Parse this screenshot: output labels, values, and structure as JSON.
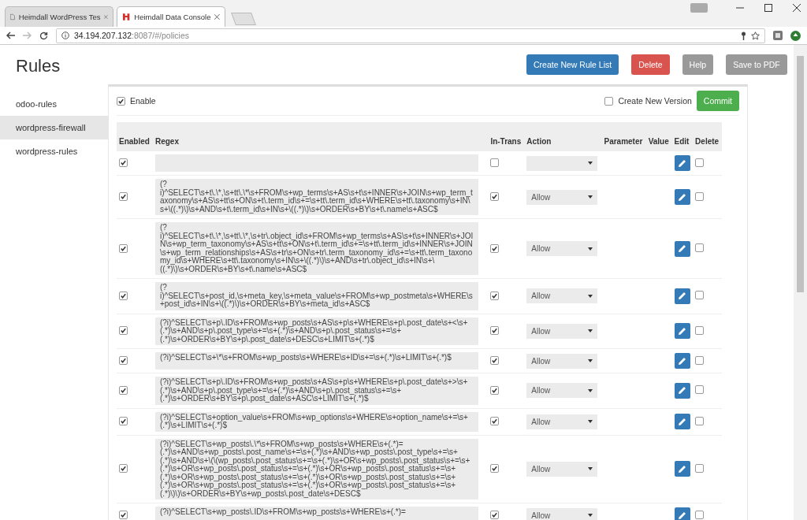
{
  "browser": {
    "tabs": [
      {
        "title": "Heimdall WordPress Tes",
        "kind": "page",
        "selected": false
      },
      {
        "title": "Heimdall Data Console",
        "kind": "logo",
        "selected": true
      }
    ],
    "url": {
      "host": "34.194.207.132",
      "rest": ":8087/#/policies"
    }
  },
  "page": {
    "title": "Rules",
    "buttons": [
      {
        "label": "Create New Rule List",
        "kind": "primary"
      },
      {
        "label": "Delete",
        "kind": "danger"
      },
      {
        "label": "Help",
        "kind": "default"
      },
      {
        "label": "Save to PDF",
        "kind": "default"
      }
    ]
  },
  "sidebar": {
    "items": [
      {
        "label": "odoo-rules",
        "selected": false
      },
      {
        "label": "wordpress-firewall",
        "selected": true
      },
      {
        "label": "wordpress-rules",
        "selected": false
      }
    ]
  },
  "panel": {
    "enable": {
      "label": "Enable",
      "checked": true
    },
    "new_version": {
      "label": "Create New Version",
      "checked": false
    },
    "commit": "Commit"
  },
  "table": {
    "columns": [
      "Enabled",
      "Regex",
      "In-Trans",
      "Action",
      "Parameter",
      "Value",
      "Edit",
      "Delete"
    ],
    "rows": [
      {
        "enabled": true,
        "regex": "",
        "in_trans": false,
        "action": "",
        "delete": false
      },
      {
        "enabled": true,
        "regex": "(?i)^SELECT\\s+t\\.\\*,\\s+tt\\.\\*\\s+FROM\\s+wp_terms\\s+AS\\s+t\\s+INNER\\s+JOIN\\s+wp_term_taxonomy\\s+AS\\s+tt\\s+ON\\s+t\\.term_id\\s+=\\s+tt\\.term_id\\s+WHERE\\s+tt\\.taxonomy\\s+IN\\s+\\((.*)\\)\\s+AND\\s+t\\.term_id\\s+IN\\s+\\((.*)\\)\\s+ORDER\\s+BY\\s+t\\.name\\s+ASC$",
        "in_trans": true,
        "action": "Allow",
        "delete": false
      },
      {
        "enabled": true,
        "regex": "(?i)^SELECT\\s+t\\.\\*,\\s+tt\\.\\*,\\s+tr\\.object_id\\s+FROM\\s+wp_terms\\s+AS\\s+t\\s+INNER\\s+JOIN\\s+wp_term_taxonomy\\s+AS\\s+tt\\s+ON\\s+t\\.term_id\\s+=\\s+tt\\.term_id\\s+INNER\\s+JOIN\\s+wp_term_relationships\\s+AS\\s+tr\\s+ON\\s+tr\\.term_taxonomy_id\\s+=\\s+tt\\.term_taxonomy_id\\s+WHERE\\s+tt\\.taxonomy\\s+IN\\s+\\((.*)\\)\\s+AND\\s+tr\\.object_id\\s+IN\\s+\\((.*)\\)\\s+ORDER\\s+BY\\s+t\\.name\\s+ASC$",
        "in_trans": true,
        "action": "Allow",
        "delete": false
      },
      {
        "enabled": true,
        "regex": "(?i)^SELECT\\s+post_id,\\s+meta_key,\\s+meta_value\\s+FROM\\s+wp_postmeta\\s+WHERE\\s+post_id\\s+IN\\s+\\((.*)\\)\\s+ORDER\\s+BY\\s+meta_id\\s+ASC$",
        "in_trans": true,
        "action": "Allow",
        "delete": false
      },
      {
        "enabled": true,
        "regex": "(?i)^SELECT\\s+p\\.ID\\s+FROM\\s+wp_posts\\s+AS\\s+p\\s+WHERE\\s+p\\.post_date\\s+<\\s+(.*)\\s+AND\\s+p\\.post_type\\s+=\\s+(.*)\\s+AND\\s+p\\.post_status\\s+=\\s+(.*)\\s+ORDER\\s+BY\\s+p\\.post_date\\s+DESC\\s+LIMIT\\s+(.*)$",
        "in_trans": true,
        "action": "Allow",
        "delete": false
      },
      {
        "enabled": true,
        "regex": "(?i)^SELECT\\s+\\*\\s+FROM\\s+wp_posts\\s+WHERE\\s+ID\\s+=\\s+(.*)\\s+LIMIT\\s+(.*)$",
        "in_trans": true,
        "action": "Allow",
        "delete": false
      },
      {
        "enabled": true,
        "regex": "(?i)^SELECT\\s+p\\.ID\\s+FROM\\s+wp_posts\\s+AS\\s+p\\s+WHERE\\s+p\\.post_date\\s+>\\s+(.*)\\s+AND\\s+p\\.post_type\\s+=\\s+(.*)\\s+AND\\s+p\\.post_status\\s+=\\s+(.*)\\s+ORDER\\s+BY\\s+p\\.post_date\\s+ASC\\s+LIMIT\\s+(.*)$",
        "in_trans": true,
        "action": "Allow",
        "delete": false
      },
      {
        "enabled": true,
        "regex": "(?i)^SELECT\\s+option_value\\s+FROM\\s+wp_options\\s+WHERE\\s+option_name\\s+=\\s+(.*)\\s+LIMIT\\s+(.*)$",
        "in_trans": true,
        "action": "Allow",
        "delete": false
      },
      {
        "enabled": true,
        "regex": "(?i)^SELECT\\s+wp_posts\\.\\*\\s+FROM\\s+wp_posts\\s+WHERE\\s+(.*)=(.*)\\s+AND\\s+wp_posts\\.post_name\\s+=\\s+(.*)\\s+AND\\s+wp_posts\\.post_type\\s+=\\s+(.*)\\s+AND\\s+\\(\\(wp_posts\\.post_status\\s+=\\s+(.*)\\s+OR\\s+wp_posts\\.post_status\\s+=\\s+(.*)\\s+OR\\s+wp_posts\\.post_status\\s+=\\s+(.*)\\s+OR\\s+wp_posts\\.post_status\\s+=\\s+(.*)\\s+OR\\s+wp_posts\\.post_status\\s+=\\s+(.*)\\s+OR\\s+wp_posts\\.post_status\\s+=\\s+(.*)\\s+OR\\s+wp_posts\\.post_status\\s+=\\s+(.*)\\s+OR\\s+wp_posts\\.post_status\\s+=\\s+(.*)\\)\\)\\s+ORDER\\s+BY\\s+wp_posts\\.post_date\\s+DESC$",
        "in_trans": true,
        "action": "Allow",
        "delete": false
      },
      {
        "enabled": true,
        "regex": "(?i)^SELECT\\s+wp_posts\\.ID\\s+FROM\\s+wp_posts\\s+WHERE\\s+(.*)=",
        "in_trans": true,
        "action": "Allow",
        "delete": false
      }
    ]
  }
}
